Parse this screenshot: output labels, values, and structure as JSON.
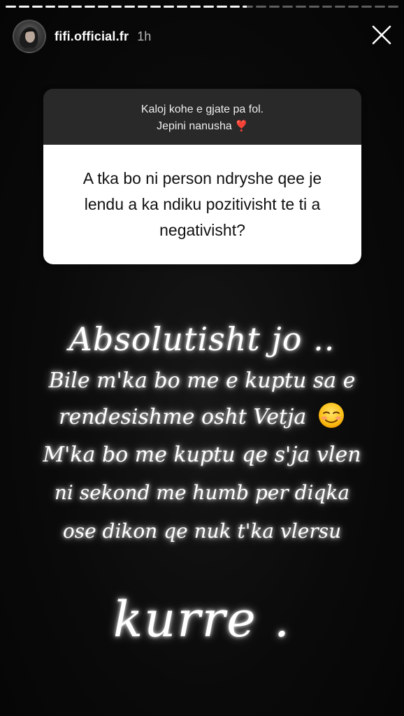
{
  "story": {
    "progress": [
      1,
      1,
      1,
      1,
      1,
      1,
      1,
      1,
      1,
      1,
      1,
      1,
      1,
      1,
      1,
      1,
      1,
      1,
      0.4,
      0,
      0,
      0,
      0,
      0,
      0,
      0,
      0,
      0,
      0,
      0
    ]
  },
  "header": {
    "username": "fifi.official.fr",
    "time_ago": "1h"
  },
  "question": {
    "prompt_line1": "Kaloj kohe e gjate pa fol.",
    "prompt_line2": "Jepini nanusha",
    "heart_emoji": "❣️",
    "text": "A tka bo ni person ndryshe qee je lendu a ka ndiku pozitivisht te ti a negativisht?"
  },
  "answer": {
    "line1": "Absolutisht jo ..",
    "line2": "Bile m'ka bo me e kuptu sa e",
    "line3": "rendesishme osht Vetja",
    "line4": "M'ka bo me kuptu qe s'ja vlen",
    "line5": "ni sekond me humb per diqka",
    "line6": "ose dikon qe nuk t'ka vlersu",
    "line7": "kurre ."
  },
  "icons": {
    "close": "close-icon",
    "emoji": "smiling-face-emoji"
  },
  "colors": {
    "background": "#000000",
    "card_top": "#292929",
    "card_bottom": "#ffffff",
    "heart": "#e0245e"
  }
}
